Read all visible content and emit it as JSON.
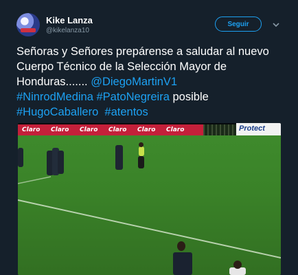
{
  "user": {
    "name": "Kike Lanza",
    "handle": "@kikelanza10"
  },
  "follow_label": "Seguir",
  "tweet": {
    "text_1": "Señoras y Señores prepárense a saludar al nuevo Cuerpo Técnico de la Selección Mayor de Honduras....... ",
    "mention": "@DiegoMartinV1",
    "hashtag_1": "#NinrodMedina",
    "hashtag_2": "#PatoNegreira",
    "word_posible": "posible",
    "hashtag_3": "#HugoCaballero",
    "hashtag_4": "#atentos"
  },
  "media": {
    "ad_brand": "Claro",
    "ad_right": "Protect"
  },
  "icons": {
    "avatar": "profile-avatar",
    "chevron": "chevron-down-icon"
  },
  "colors": {
    "background": "#15202b",
    "link": "#1da1f2",
    "secondary_text": "#8899a6",
    "ad_red": "#c4203a"
  }
}
